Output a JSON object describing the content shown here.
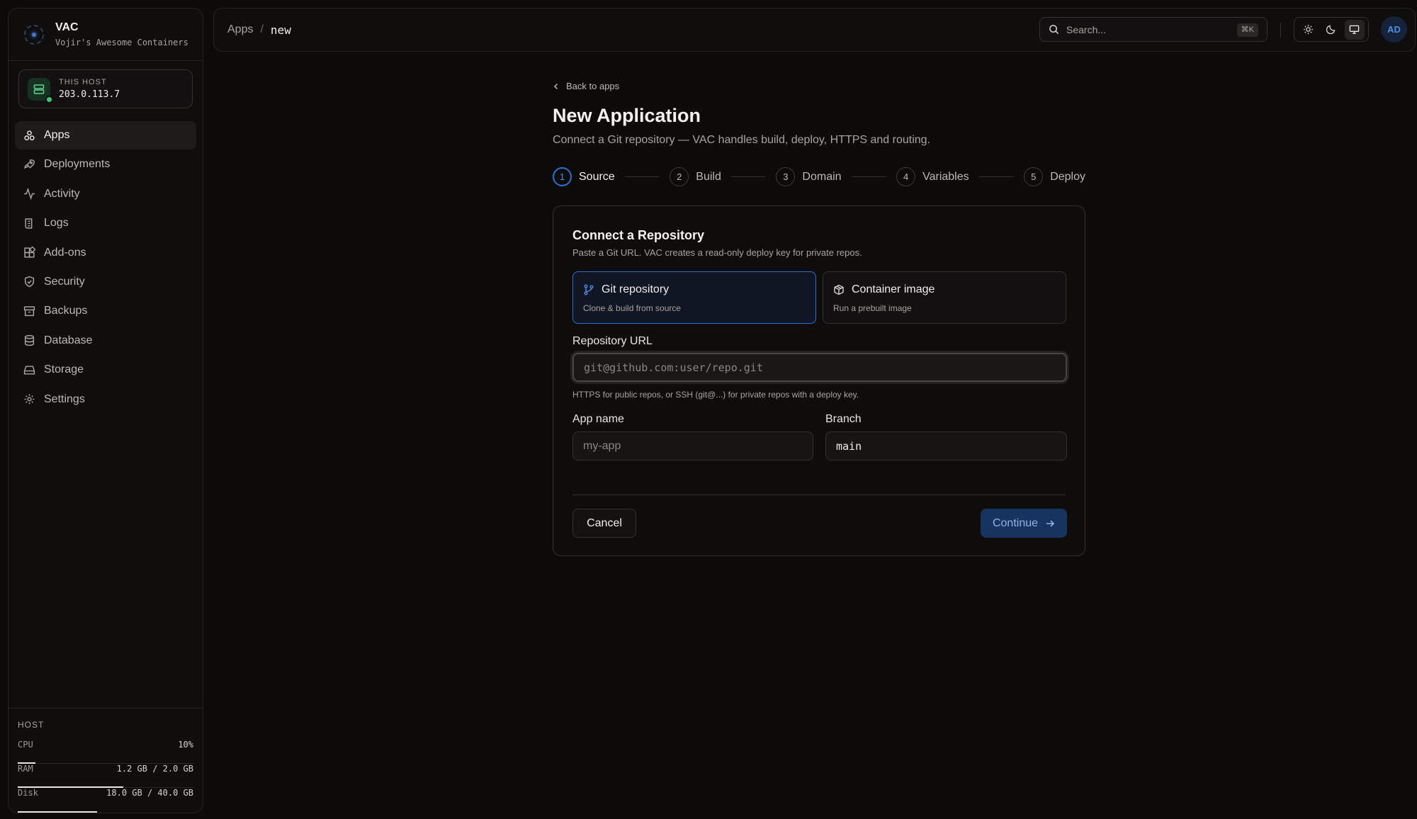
{
  "brand": {
    "name": "VAC",
    "subtitle": "Vojir's Awesome Containers"
  },
  "host_card": {
    "label": "THIS HOST",
    "ip": "203.0.113.7",
    "status_color": "#3ec46d"
  },
  "nav": [
    {
      "label": "Apps",
      "icon": "apps-icon",
      "active": true
    },
    {
      "label": "Deployments",
      "icon": "rocket-icon"
    },
    {
      "label": "Activity",
      "icon": "activity-icon"
    },
    {
      "label": "Logs",
      "icon": "logs-icon"
    },
    {
      "label": "Add-ons",
      "icon": "addons-icon"
    },
    {
      "label": "Security",
      "icon": "shield-icon"
    },
    {
      "label": "Backups",
      "icon": "archive-icon"
    },
    {
      "label": "Database",
      "icon": "database-icon"
    },
    {
      "label": "Storage",
      "icon": "storage-icon"
    },
    {
      "label": "Settings",
      "icon": "gear-icon"
    }
  ],
  "host_metrics": {
    "title": "HOST",
    "cpu": {
      "label": "CPU",
      "value": "10%",
      "fraction": 0.1
    },
    "ram": {
      "label": "RAM",
      "value": "1.2 GB / 2.0 GB",
      "fraction": 0.6
    },
    "disk": {
      "label": "Disk",
      "value": "18.0 GB / 40.0 GB",
      "fraction": 0.45
    }
  },
  "breadcrumb": {
    "parent": "Apps",
    "separator": "/",
    "current": "new"
  },
  "search": {
    "placeholder": "Search...",
    "shortcut": "⌘K"
  },
  "theme": {
    "options": [
      "light",
      "dark",
      "system"
    ],
    "selected": "system"
  },
  "avatar": {
    "initials": "AD"
  },
  "page": {
    "back_label": "Back to apps",
    "title": "New Application",
    "subtitle": "Connect a Git repository — VAC handles build, deploy, HTTPS and routing."
  },
  "steps": [
    {
      "num": "1",
      "label": "Source",
      "active": true
    },
    {
      "num": "2",
      "label": "Build"
    },
    {
      "num": "3",
      "label": "Domain"
    },
    {
      "num": "4",
      "label": "Variables"
    },
    {
      "num": "5",
      "label": "Deploy"
    }
  ],
  "card": {
    "title": "Connect a Repository",
    "subtitle": "Paste a Git URL. VAC creates a read-only deploy key for private repos.",
    "source_options": [
      {
        "title": "Git repository",
        "desc": "Clone & build from source",
        "selected": true
      },
      {
        "title": "Container image",
        "desc": "Run a prebuilt image"
      }
    ],
    "repo_url": {
      "label": "Repository URL",
      "value": "",
      "placeholder": "git@github.com:user/repo.git",
      "hint": "HTTPS for public repos, or SSH (git@...) for private repos with a deploy key."
    },
    "app_name": {
      "label": "App name",
      "value": "",
      "placeholder": "my-app"
    },
    "branch": {
      "label": "Branch",
      "value": "main",
      "placeholder": ""
    },
    "cancel_label": "Cancel",
    "continue_label": "Continue"
  },
  "colors": {
    "accent": "#2f6fd1",
    "background": "#0d0b0a"
  }
}
